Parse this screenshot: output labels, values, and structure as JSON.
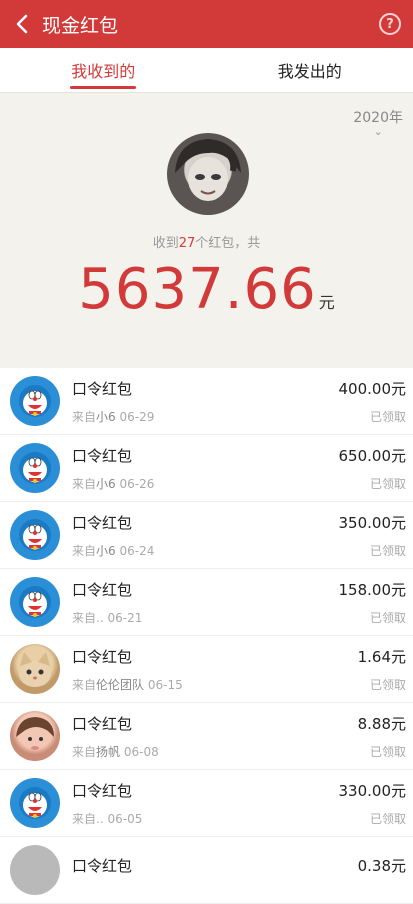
{
  "header": {
    "title": "现金红包",
    "help_icon": "?"
  },
  "tabs": [
    {
      "label": "我收到的",
      "active": true
    },
    {
      "label": "我发出的",
      "active": false
    }
  ],
  "summary": {
    "year": "2020年",
    "received_prefix": "收到",
    "received_count": "27",
    "received_suffix": "个红包，共",
    "total": "5637.66",
    "unit": "元"
  },
  "items": [
    {
      "title": "口令红包",
      "from_prefix": "来自",
      "from": "小6",
      "date": "06-29",
      "amount": "400.00元",
      "status": "已领取",
      "avatar": "doraemon"
    },
    {
      "title": "口令红包",
      "from_prefix": "来自",
      "from": "小6",
      "date": "06-26",
      "amount": "650.00元",
      "status": "已领取",
      "avatar": "doraemon"
    },
    {
      "title": "口令红包",
      "from_prefix": "来自",
      "from": "小6",
      "date": "06-24",
      "amount": "350.00元",
      "status": "已领取",
      "avatar": "doraemon"
    },
    {
      "title": "口令红包",
      "from_prefix": "来自..",
      "from": "",
      "date": "06-21",
      "amount": "158.00元",
      "status": "已领取",
      "avatar": "doraemon"
    },
    {
      "title": "口令红包",
      "from_prefix": "来自",
      "from": "伦伦团队",
      "date": "06-15",
      "amount": "1.64元",
      "status": "已领取",
      "avatar": "cat"
    },
    {
      "title": "口令红包",
      "from_prefix": "来自",
      "from": "扬帆",
      "date": "06-08",
      "amount": "8.88元",
      "status": "已领取",
      "avatar": "child"
    },
    {
      "title": "口令红包",
      "from_prefix": "来自..",
      "from": "",
      "date": "06-05",
      "amount": "330.00元",
      "status": "已领取",
      "avatar": "doraemon"
    },
    {
      "title": "口令红包",
      "from_prefix": "",
      "from": "",
      "date": "",
      "amount": "0.38元",
      "status": "",
      "avatar": "grey"
    }
  ]
}
